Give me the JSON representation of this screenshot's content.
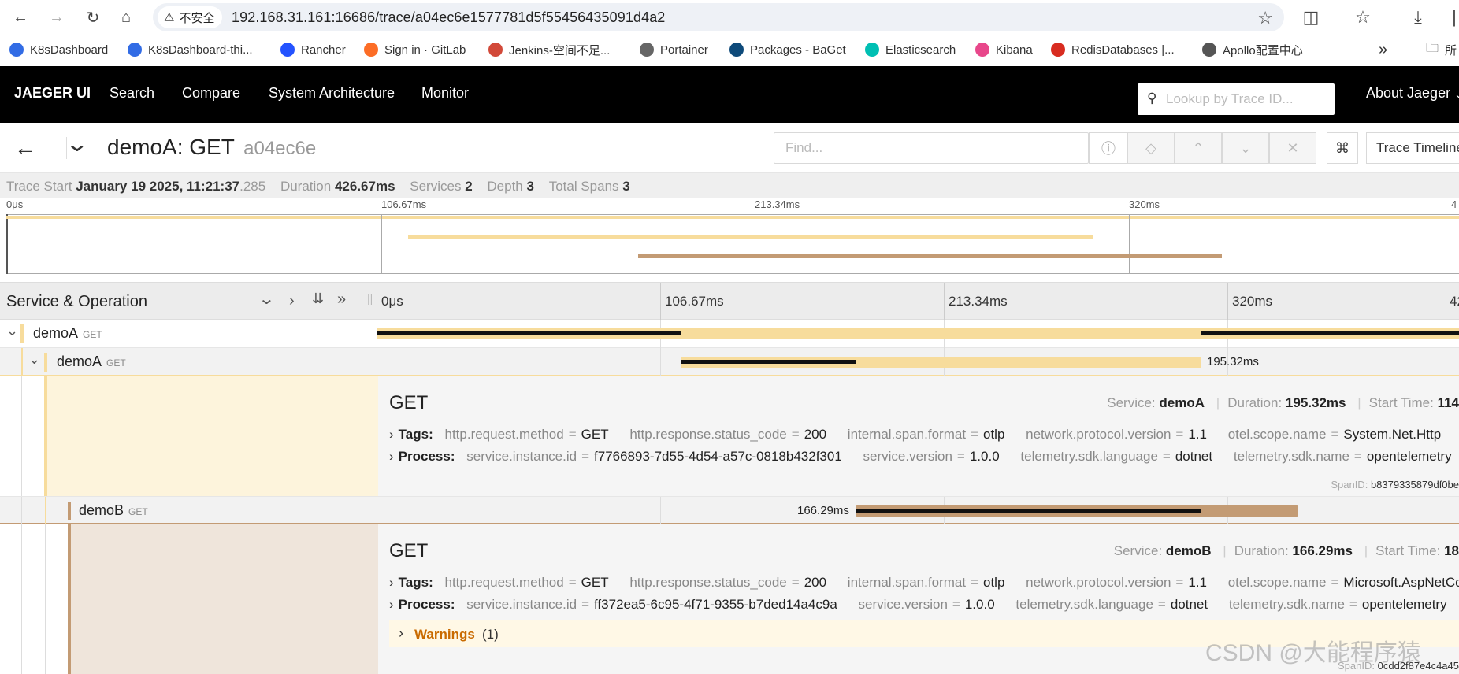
{
  "browser": {
    "insecure_label": "不安全",
    "url": "192.168.31.161:16686/trace/a04ec6e1577781d5f55456435091d4a2"
  },
  "bookmarks": [
    {
      "label": "K8sDashboard",
      "icon": "k8s-icon",
      "color": "#326ce5"
    },
    {
      "label": "K8sDashboard-thi...",
      "icon": "kubernetes-icon",
      "color": "#326ce5"
    },
    {
      "label": "Rancher",
      "icon": "rancher-icon",
      "color": "#2453ff"
    },
    {
      "label": "Sign in · GitLab",
      "icon": "gitlab-icon",
      "color": "#fc6d26"
    },
    {
      "label": "Jenkins-空间不足...",
      "icon": "jenkins-icon",
      "color": "#d24939"
    },
    {
      "label": "Portainer",
      "icon": "globe-icon",
      "color": "#666"
    },
    {
      "label": "Packages - BaGet",
      "icon": "baget-icon",
      "color": "#0e4a7a"
    },
    {
      "label": "Elasticsearch",
      "icon": "elastic-icon",
      "color": "#00bfb3"
    },
    {
      "label": "Kibana",
      "icon": "kibana-icon",
      "color": "#e8478b"
    },
    {
      "label": "RedisDatabases |...",
      "icon": "redis-icon",
      "color": "#d82c20"
    },
    {
      "label": "Apollo配置中心",
      "icon": "apollo-icon",
      "color": "#555"
    }
  ],
  "bookmarks_overflow": "»",
  "bookmarks_folder_label": "所",
  "jaeger_nav": {
    "brand": "JAEGER UI",
    "items": [
      "Search",
      "Compare",
      "System Architecture",
      "Monitor"
    ],
    "lookup_placeholder": "Lookup by Trace ID...",
    "about": "About Jaeger"
  },
  "trace": {
    "service": "demoA: GET",
    "trace_id_short": "a04ec6e",
    "find_placeholder": "Find...",
    "view_mode": "Trace Timeline"
  },
  "summary": {
    "trace_start_label": "Trace Start",
    "trace_start_value": "January 19 2025, 11:21:37",
    "trace_start_ms": ".285",
    "duration_label": "Duration",
    "duration_value": "426.67ms",
    "services_label": "Services",
    "services_value": "2",
    "depth_label": "Depth",
    "depth_value": "3",
    "total_spans_label": "Total Spans",
    "total_spans_value": "3"
  },
  "minimap_ticks": [
    "0μs",
    "106.67ms",
    "213.34ms",
    "320ms",
    "4"
  ],
  "span_header": {
    "title": "Service & Operation",
    "ticks": [
      "0μs",
      "106.67ms",
      "213.34ms",
      "320ms",
      "42"
    ]
  },
  "spans": [
    {
      "service": "demoA",
      "op": "GET",
      "label": ""
    },
    {
      "service": "demoA",
      "op": "GET",
      "label": "195.32ms"
    },
    {
      "service": "demoB",
      "op": "GET",
      "label": "166.29ms"
    }
  ],
  "details": [
    {
      "title": "GET",
      "service_label": "Service:",
      "service": "demoA",
      "duration_label": "Duration:",
      "duration": "195.32ms",
      "start_label": "Start Time:",
      "start": "114",
      "tags_label": "Tags:",
      "tags": [
        {
          "k": "http.request.method",
          "v": "GET"
        },
        {
          "k": "http.response.status_code",
          "v": "200"
        },
        {
          "k": "internal.span.format",
          "v": "otlp"
        },
        {
          "k": "network.protocol.version",
          "v": "1.1"
        },
        {
          "k": "otel.scope.name",
          "v": "System.Net.Http"
        }
      ],
      "process_label": "Process:",
      "process": [
        {
          "k": "service.instance.id",
          "v": "f7766893-7d55-4d54-a57c-0818b432f301"
        },
        {
          "k": "service.version",
          "v": "1.0.0"
        },
        {
          "k": "telemetry.sdk.language",
          "v": "dotnet"
        },
        {
          "k": "telemetry.sdk.name",
          "v": "opentelemetry"
        }
      ],
      "span_id_label": "SpanID:",
      "span_id": "b8379335879df0be"
    },
    {
      "title": "GET",
      "service_label": "Service:",
      "service": "demoB",
      "duration_label": "Duration:",
      "duration": "166.29ms",
      "start_label": "Start Time:",
      "start": "18",
      "tags_label": "Tags:",
      "tags": [
        {
          "k": "http.request.method",
          "v": "GET"
        },
        {
          "k": "http.response.status_code",
          "v": "200"
        },
        {
          "k": "internal.span.format",
          "v": "otlp"
        },
        {
          "k": "network.protocol.version",
          "v": "1.1"
        },
        {
          "k": "otel.scope.name",
          "v": "Microsoft.AspNetCo"
        }
      ],
      "process_label": "Process:",
      "process": [
        {
          "k": "service.instance.id",
          "v": "ff372ea5-6c95-4f71-9355-b7ded14a4c9a"
        },
        {
          "k": "service.version",
          "v": "1.0.0"
        },
        {
          "k": "telemetry.sdk.language",
          "v": "dotnet"
        },
        {
          "k": "telemetry.sdk.name",
          "v": "opentelemetry"
        }
      ],
      "warnings_label": "Warnings",
      "warnings_count": "(1)",
      "span_id_label": "SpanID:",
      "span_id": "0cdd2f87e4c4a45"
    }
  ],
  "watermark": "CSDN @大能程序猿",
  "colors": {
    "demoA": "#f7dc9c",
    "demoB": "#c39b74",
    "bar_critical": "#111111",
    "nav_bg": "#000000",
    "warning": "#c96a00"
  }
}
